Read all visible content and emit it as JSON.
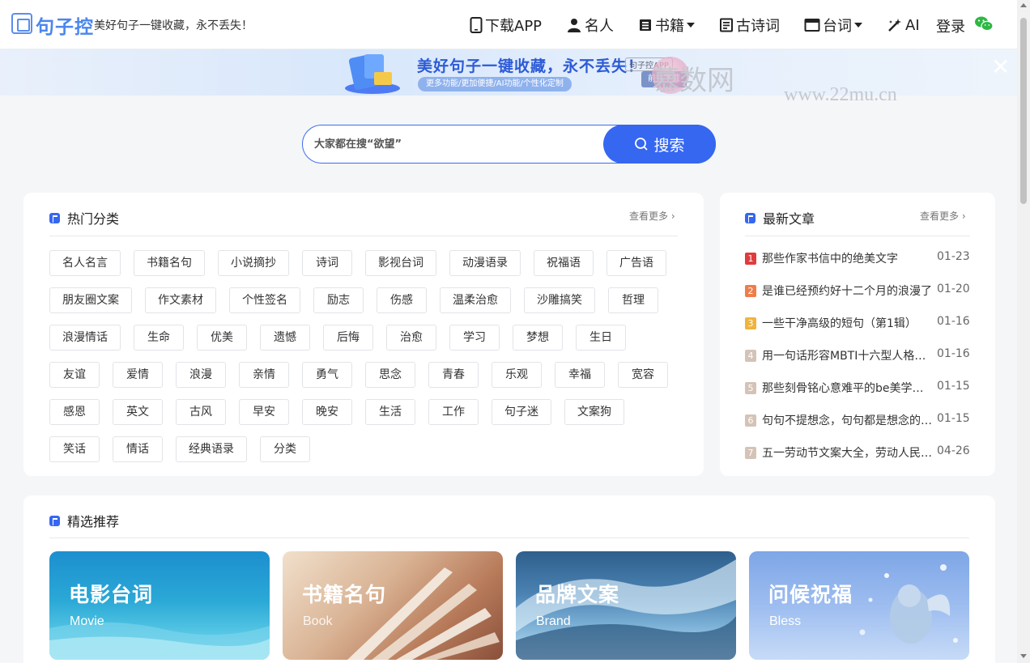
{
  "header": {
    "logo_text": "句子控",
    "slogan": "美好句子一键收藏，永不丢失！",
    "nav": [
      {
        "label": "下载APP",
        "icon": "phone-icon"
      },
      {
        "label": "名人",
        "icon": "person-icon"
      },
      {
        "label": "书籍",
        "icon": "book-icon",
        "dropdown": true
      },
      {
        "label": "古诗词",
        "icon": "document-icon"
      },
      {
        "label": "台词",
        "icon": "clapper-icon",
        "dropdown": true
      },
      {
        "label": "AI",
        "icon": "magic-wand-icon"
      }
    ],
    "login": "登录",
    "wechat_icon": "wechat-icon"
  },
  "banner": {
    "title": "美好句子一键收藏，永不丢失！",
    "subtitle": "更多功能/更加便捷/AI功能/个性化定制",
    "app_label": "句子控APP",
    "download": "前往下载"
  },
  "watermark": {
    "text": "慕数网",
    "url": "www.22mu.cn"
  },
  "search": {
    "placeholder": "大家都在搜“欲望”",
    "button": "搜索"
  },
  "hot": {
    "title": "热门分类",
    "more": "查看更多",
    "tags": [
      [
        "名人名言",
        "书籍名句",
        "小说摘抄",
        "诗词",
        "影视台词",
        "动漫语录",
        "祝福语",
        "广告语"
      ],
      [
        "朋友圈文案",
        "作文素材",
        "个性签名",
        "励志",
        "伤感",
        "温柔治愈",
        "沙雕搞笑",
        "哲理"
      ],
      [
        "浪漫情话",
        "生命",
        "优美",
        "遗憾",
        "后悔",
        "治愈",
        "学习",
        "梦想",
        "生日"
      ],
      [
        "友谊",
        "爱情",
        "浪漫",
        "亲情",
        "勇气",
        "思念",
        "青春",
        "乐观",
        "幸福",
        "宽容"
      ],
      [
        "感恩",
        "英文",
        "古风",
        "早安",
        "晚安",
        "生活",
        "工作",
        "句子迷",
        "文案狗"
      ],
      [
        "笑话",
        "情话",
        "经典语录",
        "分类"
      ]
    ]
  },
  "news": {
    "title": "最新文章",
    "more": "查看更多",
    "items": [
      {
        "num": "1",
        "title": "那些作家书信中的绝美文字",
        "date": "01-23",
        "color": "#e03c3c"
      },
      {
        "num": "2",
        "title": "是谁已经预约好十二个月的浪漫了",
        "date": "01-20",
        "color": "#ef7d4a"
      },
      {
        "num": "3",
        "title": "一些干净高级的短句（第1辑）",
        "date": "01-16",
        "color": "#f0b43c"
      },
      {
        "num": "4",
        "title": "用一句话形容MBTI十六型人格的特点",
        "date": "01-16",
        "color": "#d4c3b6"
      },
      {
        "num": "5",
        "title": "那些刻骨铭心意难平的be美学文案",
        "date": "01-15",
        "color": "#d4c3b6"
      },
      {
        "num": "6",
        "title": "句句不提想念，句句都是想念的句子",
        "date": "01-15",
        "color": "#d4c3b6"
      },
      {
        "num": "7",
        "title": "五一劳动节文案大全，劳动人民最光荣",
        "date": "04-26",
        "color": "#d4c3b6"
      }
    ]
  },
  "recommend": {
    "title": "精选推荐",
    "tiles": [
      {
        "title": "电影台词",
        "sub": "Movie"
      },
      {
        "title": "书籍名句",
        "sub": "Book"
      },
      {
        "title": "品牌文案",
        "sub": "Brand"
      },
      {
        "title": "问候祝福",
        "sub": "Bless"
      }
    ]
  }
}
